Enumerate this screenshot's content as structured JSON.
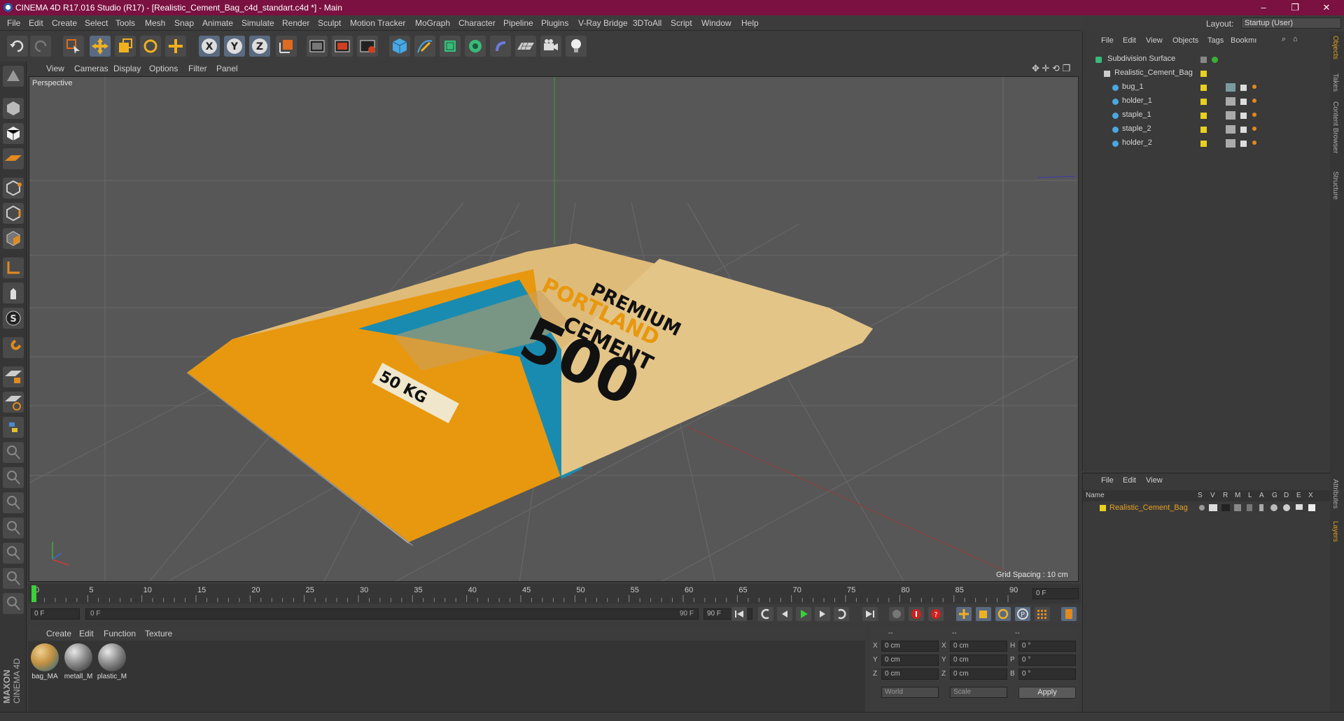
{
  "title": "CINEMA 4D R17.016 Studio (R17) - [Realistic_Cement_Bag_c4d_standart.c4d *] - Main",
  "window_controls": {
    "minimize": "–",
    "maximize": "❐",
    "close": "✕"
  },
  "menu": [
    "File",
    "Edit",
    "Create",
    "Select",
    "Tools",
    "Mesh",
    "Snap",
    "Animate",
    "Simulate",
    "Render",
    "Sculpt",
    "Motion Tracker",
    "MoGraph",
    "Character",
    "Pipeline",
    "Plugins",
    "V-Ray Bridge",
    "3DToAll",
    "Script",
    "Window",
    "Help"
  ],
  "layout": {
    "label": "Layout:",
    "value": "Startup (User)"
  },
  "viewport": {
    "menu": [
      "View",
      "Cameras",
      "Display",
      "Options",
      "Filter",
      "Panel"
    ],
    "label": "Perspective",
    "grid_spacing": "Grid Spacing : 10 cm"
  },
  "bag_text": {
    "line1": "PREMIUM",
    "line2": "PORTLAND",
    "line3": "CEMENT",
    "big": "500",
    "weight": "50 KG"
  },
  "timeline": {
    "ticks": [
      "0",
      "5",
      "10",
      "15",
      "20",
      "25",
      "30",
      "35",
      "40",
      "45",
      "50",
      "55",
      "60",
      "65",
      "70",
      "75",
      "80",
      "85",
      "90"
    ],
    "current": "0 F"
  },
  "controls": {
    "start": "0 F",
    "range_start": "0 F",
    "range_end": "90 F",
    "end": "90 F"
  },
  "materials": {
    "menu": [
      "Create",
      "Edit",
      "Function",
      "Texture"
    ],
    "items": [
      "bag_MA",
      "metall_M",
      "plastic_M"
    ]
  },
  "coords": {
    "header": [
      "--",
      "--",
      "--"
    ],
    "rows": [
      {
        "a": "X",
        "av": "0 cm",
        "b": "X",
        "bv": "0 cm",
        "c": "H",
        "cv": "0 °"
      },
      {
        "a": "Y",
        "av": "0 cm",
        "b": "Y",
        "bv": "0 cm",
        "c": "P",
        "cv": "0 °"
      },
      {
        "a": "Z",
        "av": "0 cm",
        "b": "Z",
        "bv": "0 cm",
        "c": "B",
        "cv": "0 °"
      }
    ],
    "world": "World",
    "scale": "Scale",
    "apply": "Apply"
  },
  "objects": {
    "menu": [
      "File",
      "Edit",
      "View",
      "Objects",
      "Tags",
      "Bookmı"
    ],
    "items": [
      "Subdivision Surface",
      "Realistic_Cement_Bag",
      "bug_1",
      "holder_1",
      "staple_1",
      "staple_2",
      "holder_2"
    ]
  },
  "layers": {
    "menu": [
      "File",
      "Edit",
      "View"
    ],
    "name_header": "Name",
    "cols": [
      "S",
      "V",
      "R",
      "M",
      "L",
      "A",
      "G",
      "D",
      "E",
      "X"
    ],
    "item": "Realistic_Cement_Bag"
  },
  "sidetabs": [
    "Objects",
    "Takes",
    "Content Browser",
    "Structure",
    "Attributes",
    "Layers"
  ],
  "maxon": {
    "brand": "MAXON",
    "product": "CINEMA 4D"
  },
  "colors": {
    "title_bg": "#7a1140",
    "bag_orange": "#e89a10",
    "bag_blue": "#1a8bb0",
    "bag_cream": "#e8c88a"
  }
}
